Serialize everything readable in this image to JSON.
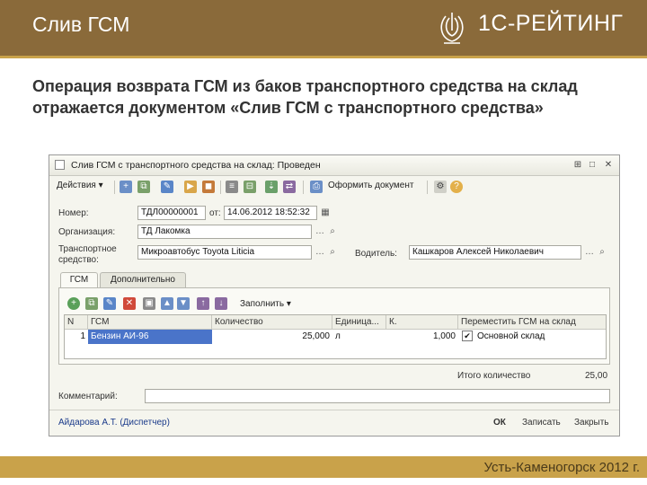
{
  "slide": {
    "title": "Слив ГСМ",
    "brand": "1С-РЕЙТИНГ",
    "body": "Операция возврата ГСМ из баков транспортного средства на склад отражается документом «Слив ГСМ с транспортного средства»",
    "footer": "Усть-Каменогорск 2012 г.",
    "colors": {
      "header": "#8a6a3a",
      "accent": "#c9a24a",
      "selected_row": "#4a74c9"
    }
  },
  "window": {
    "title": "Слив ГСМ с транспортного средства на склад: Проведен",
    "controls": [
      "⊞",
      "□",
      "✕"
    ],
    "toolbar": {
      "actions_label": "Действия",
      "post_document_label": "Оформить документ",
      "help_icon_label": "?"
    },
    "form": {
      "number_label": "Номер:",
      "number_value": "ТДЛ00000001",
      "from_label": "от:",
      "date_value": "14.06.2012 18:52:32",
      "organization_label": "Организация:",
      "organization_value": "ТД Лакомка",
      "vehicle_label": "Транспортное средство:",
      "vehicle_value": "Микроавтобус Toyota Liticia",
      "driver_label": "Водитель:",
      "driver_value": "Кашкаров Алексей Николаевич"
    },
    "tabs": [
      "ГСМ",
      "Дополнительно"
    ],
    "grid_toolbar": {
      "fill_label": "Заполнить"
    },
    "grid": {
      "columns": [
        "N",
        "ГСМ",
        "Количество",
        "Единица...",
        "К.",
        "Переместить ГСМ на склад"
      ],
      "rows": [
        {
          "n": "1",
          "fuel": "Бензин АИ-96",
          "qty": "25,000",
          "unit": "л",
          "k": "1,000",
          "move_checked": true,
          "warehouse": "Основной склад"
        }
      ]
    },
    "total_label": "Итого количество",
    "total_value": "25,00",
    "comment_label": "Комментарий:",
    "comment_value": "",
    "author": "Айдарова А.Т. (Диспетчер)",
    "buttons": {
      "ok": "ОК",
      "save": "Записать",
      "close": "Закрыть"
    }
  }
}
